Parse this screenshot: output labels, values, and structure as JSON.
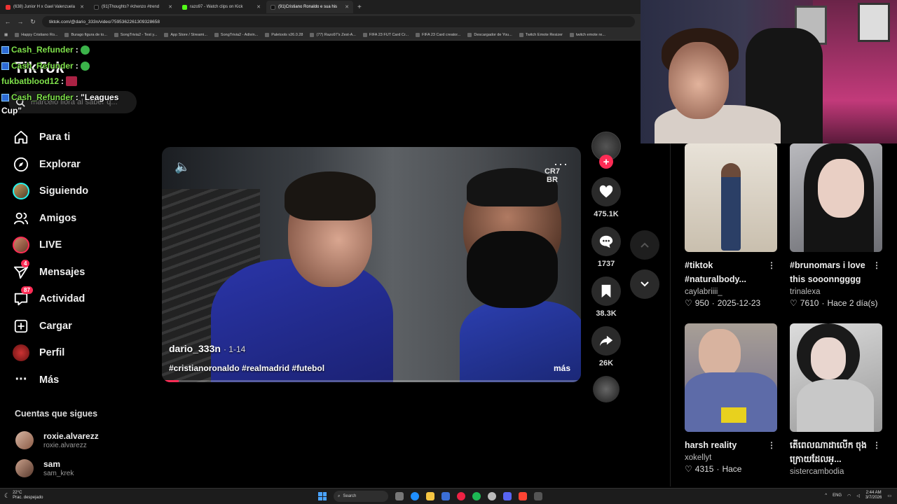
{
  "browser": {
    "tabs": [
      {
        "label": "(638) Junior H x Gael Valenzuela",
        "color": "#e33"
      },
      {
        "label": "(91)Thoughts? #chenzo #trend",
        "color": "#222"
      },
      {
        "label": "razo97 - Watch clips on Kick",
        "color": "#53fc18"
      },
      {
        "label": "(91)Cristiano Ronaldo e sua his",
        "color": "#222"
      }
    ],
    "url": "tiktok.com/@dario_333n/video/7595362261309328658",
    "bookmarks": [
      "Happy Cristiano Ro...",
      "Burago figura de to...",
      "SongTrivia2 - Test y...",
      "App Store / Streami...",
      "SongTrivia2 - Adivin...",
      "Paletools v26.0.28",
      "(77) Razo97's Zest-A...",
      "FIFA 23 FUT Card Cr...",
      "FIFA 23 Card creator...",
      "Descargador de You...",
      "Twitch Emote Resizer",
      "twitch emote re..."
    ]
  },
  "tiktok": {
    "logo": "TikTok",
    "search_placeholder": "marcelo llora al saber q...",
    "nav": [
      {
        "label": "Para ti",
        "icon": "home-icon",
        "badge": ""
      },
      {
        "label": "Explorar",
        "icon": "compass-icon",
        "badge": ""
      },
      {
        "label": "Siguiendo",
        "icon": "following-avatar-icon",
        "badge": ""
      },
      {
        "label": "Amigos",
        "icon": "friends-icon",
        "badge": ""
      },
      {
        "label": "LIVE",
        "icon": "live-avatar-icon",
        "badge": ""
      },
      {
        "label": "Mensajes",
        "icon": "send-icon",
        "badge": "4"
      },
      {
        "label": "Actividad",
        "icon": "inbox-icon",
        "badge": "87"
      },
      {
        "label": "Cargar",
        "icon": "upload-icon",
        "badge": ""
      },
      {
        "label": "Perfil",
        "icon": "profile-avatar-icon",
        "badge": ""
      },
      {
        "label": "Más",
        "icon": "more-icon",
        "badge": ""
      }
    ],
    "following_title": "Cuentas que sigues",
    "following": [
      {
        "name": "roxie.alvarezz",
        "handle": "roxie.alvarezz"
      },
      {
        "name": "sam",
        "handle": "sam_krek"
      }
    ]
  },
  "chat": [
    {
      "user": "Cash_Refunder",
      "msg": ":"
    },
    {
      "user": "Cash_Refunder",
      "msg": ":"
    },
    {
      "user": "fukbatblood12",
      "msg": ":"
    },
    {
      "user": "Cash_Refunder",
      "msg": ": \"Leagues"
    },
    {
      "user": "",
      "msg": "Cup\""
    }
  ],
  "video": {
    "author": "dario_333n",
    "date": "· 1-14",
    "caption": "#cristianoronaldo #realmadrid #futebol",
    "more": "más",
    "watermark_line1": "CR7",
    "watermark_line2": "BR",
    "progress": 0.04,
    "likes": "475.1K",
    "comments": "1737",
    "saves": "38.3K",
    "shares": "26K"
  },
  "explore": [
    {
      "title": "#tiktok #naturalbody...",
      "user": "caylabriiii_",
      "likes": "950",
      "time": "2025-12-23"
    },
    {
      "title": "#brunomars i love this sooonngggg",
      "user": "trinalexa",
      "likes": "7610",
      "time": "Hace 2 día(s)"
    },
    {
      "title": "harsh reality",
      "user": "xokellyt",
      "likes": "4315",
      "time": "Hace"
    },
    {
      "title": "តើពេលណាដាលើក ចុងក្រោយដែលអ្...",
      "user": "sistercambodia",
      "likes": "",
      "time": ""
    }
  ],
  "taskbar": {
    "temp": "22°C",
    "weather": "Prac. despejado",
    "search": "Search",
    "lang": "ENG",
    "time": "2:44 AM",
    "date": "3/7/2026"
  }
}
